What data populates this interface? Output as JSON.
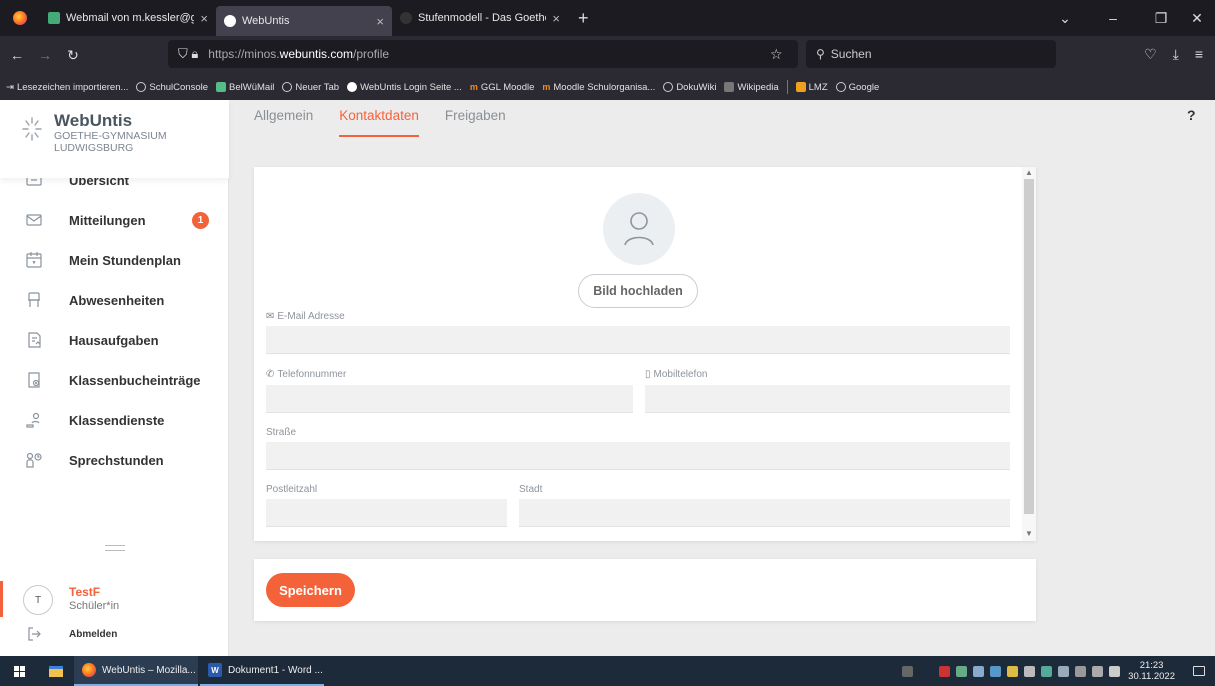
{
  "browser": {
    "tabs": [
      {
        "title": "Webmail von m.kessler@goethe-",
        "active": false,
        "favicon_color": "#4a7"
      },
      {
        "title": "WebUntis",
        "active": true,
        "favicon_color": "#1a1a1a"
      },
      {
        "title": "Stufenmodell - Das Goethe-Gy",
        "active": false,
        "favicon_color": "#333"
      }
    ],
    "url_prefix": "https://minos.",
    "url_bold": "webuntis.com",
    "url_suffix": "/profile",
    "search_placeholder": "Suchen",
    "bookmarks": [
      {
        "label": "Lesezeichen importieren...",
        "icon": "import-icon"
      },
      {
        "label": "SchulConsole",
        "icon": "globe-icon"
      },
      {
        "label": "BelWüMail",
        "icon": "mail-icon"
      },
      {
        "label": "Neuer Tab",
        "icon": "globe-icon"
      },
      {
        "label": "WebUntis Login Seite ...",
        "icon": "webuntis-icon"
      },
      {
        "label": "GGL Moodle",
        "icon": "moodle-icon"
      },
      {
        "label": "Moodle Schulorganisa...",
        "icon": "moodle-icon"
      },
      {
        "label": "DokuWiki",
        "icon": "globe-icon"
      },
      {
        "label": "Wikipedia",
        "icon": "wikipedia-icon"
      },
      {
        "label": "LMZ",
        "icon": "lmz-icon"
      },
      {
        "label": "Google",
        "icon": "globe-icon"
      }
    ]
  },
  "app": {
    "brand": {
      "name": "WebUntis",
      "school_line1": "GOETHE-GYMNASIUM",
      "school_line2": "LUDWIGSBURG"
    },
    "menu": [
      {
        "label": "Übersicht",
        "icon": "overview-icon"
      },
      {
        "label": "Mitteilungen",
        "icon": "envelope-icon",
        "badge": "1"
      },
      {
        "label": "Mein Stundenplan",
        "icon": "calendar-icon"
      },
      {
        "label": "Abwesenheiten",
        "icon": "absence-icon"
      },
      {
        "label": "Hausaufgaben",
        "icon": "homework-icon"
      },
      {
        "label": "Klassenbucheinträge",
        "icon": "classbook-icon"
      },
      {
        "label": "Klassendienste",
        "icon": "class-duty-icon"
      },
      {
        "label": "Sprechstunden",
        "icon": "office-hours-icon"
      }
    ],
    "user": {
      "initial": "T",
      "name": "TestF",
      "role": "Schüler*in"
    },
    "logout_label": "Abmelden",
    "tabs": [
      {
        "label": "Allgemein",
        "active": false
      },
      {
        "label": "Kontaktdaten",
        "active": true
      },
      {
        "label": "Freigaben",
        "active": false
      }
    ],
    "help_label": "?",
    "upload_label": "Bild hochladen",
    "fields": {
      "email": {
        "label": "E-Mail Adresse",
        "value": ""
      },
      "phone": {
        "label": "Telefonnummer",
        "value": ""
      },
      "mobile": {
        "label": "Mobiltelefon",
        "value": ""
      },
      "street": {
        "label": "Straße",
        "value": ""
      },
      "zip": {
        "label": "Postleitzahl",
        "value": ""
      },
      "city": {
        "label": "Stadt",
        "value": ""
      }
    },
    "save_label": "Speichern",
    "accent_color": "#f4623a"
  },
  "taskbar": {
    "apps": [
      {
        "label": "WebUntis – Mozilla...",
        "icon": "firefox-icon"
      },
      {
        "label": "Dokument1 - Word ...",
        "icon": "word-icon"
      }
    ],
    "time": "21:23",
    "date": "30.11.2022"
  }
}
